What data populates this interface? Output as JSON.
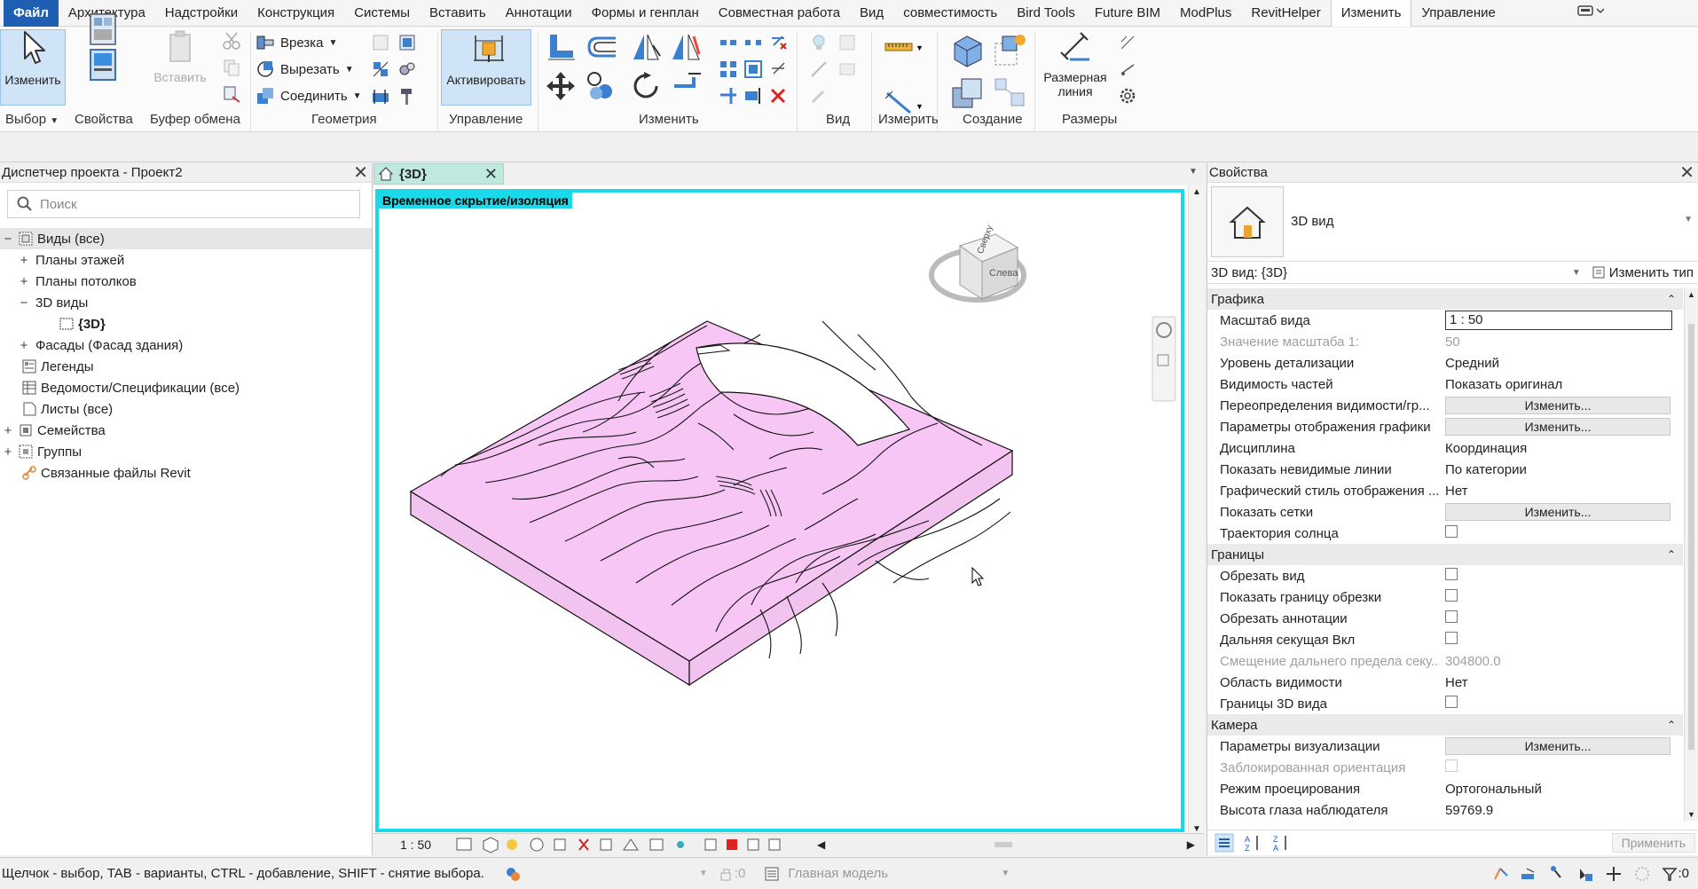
{
  "menu": {
    "items": [
      "Файл",
      "Архитектура",
      "Надстройки",
      "Конструкция",
      "Системы",
      "Вставить",
      "Аннотации",
      "Формы и генплан",
      "Совместная работа",
      "Вид",
      "совместимость",
      "Bird Tools",
      "Future BIM",
      "ModPlus",
      "RevitHelper",
      "Изменить",
      "Управление"
    ]
  },
  "ribbon": {
    "modify_label": "Изменить",
    "insert_label": "Вставить",
    "cut_small": "Врезка",
    "cutout_small": "Вырезать",
    "join_small": "Соединить",
    "activate_label": "Активировать",
    "dimension_label_1": "Размерная",
    "dimension_label_2": "линия",
    "panels": {
      "select": "Выбор",
      "properties": "Свойства",
      "clipboard": "Буфер обмена",
      "geometry": "Геометрия",
      "control": "Управление",
      "modify": "Изменить",
      "view": "Вид",
      "measure": "Измерить",
      "create": "Создание",
      "dimensions": "Размеры"
    }
  },
  "browser": {
    "title": "Диспетчер проекта - Проект2",
    "search_placeholder": "Поиск",
    "items": [
      {
        "label": "Виды (все)",
        "toggle": "−"
      },
      {
        "label": "Планы этажей",
        "toggle": "+"
      },
      {
        "label": "Планы потолков",
        "toggle": "+"
      },
      {
        "label": "3D виды",
        "toggle": "−"
      },
      {
        "label": "{3D}",
        "toggle": ""
      },
      {
        "label": "Фасады (Фасад здания)",
        "toggle": "+"
      },
      {
        "label": "Легенды",
        "toggle": ""
      },
      {
        "label": "Ведомости/Спецификации (все)",
        "toggle": ""
      },
      {
        "label": "Листы (все)",
        "toggle": ""
      },
      {
        "label": "Семейства",
        "toggle": "+"
      },
      {
        "label": "Группы",
        "toggle": "+"
      },
      {
        "label": "Связанные файлы Revit",
        "toggle": ""
      }
    ]
  },
  "view": {
    "tab_label": "{3D}",
    "isolation_label": "Временное скрытие/изоляция",
    "scale": "1 : 50",
    "viewcube_face": "Слева",
    "viewcube_top": "Сверху"
  },
  "properties": {
    "title": "Свойства",
    "type_name": "3D вид",
    "selector": "3D вид: {3D}",
    "edit_type": "Изменить тип",
    "groups": {
      "graphics": "Графика",
      "extents": "Границы",
      "camera": "Камера"
    },
    "rows": {
      "scale_name": "Масштаб вида",
      "scale_value": "1 : 50",
      "scale_val_name": "Значение масштаба    1:",
      "scale_val_value": "50",
      "detail_name": "Уровень детализации",
      "detail_value": "Средний",
      "parts_name": "Видимость частей",
      "parts_value": "Показать оригинал",
      "overrides_name": "Переопределения видимости/гр...",
      "overrides_value": "Изменить...",
      "graphics_opts_name": "Параметры отображения графики",
      "graphics_opts_value": "Изменить...",
      "discipline_name": "Дисциплина",
      "discipline_value": "Координация",
      "hidden_name": "Показать невидимые линии",
      "hidden_value": "По категории",
      "style_name": "Графический стиль отображения ...",
      "style_value": "Нет",
      "grids_name": "Показать сетки",
      "grids_value": "Изменить...",
      "sunpath_name": "Траектория солнца",
      "crop_name": "Обрезать вид",
      "cropshow_name": "Показать границу обрезки",
      "cropanno_name": "Обрезать аннотации",
      "farclip_name": "Дальняя секущая Вкл",
      "faroffset_name": "Смещение дальнего предела секу...",
      "faroffset_value": "304800.0",
      "scope_name": "Область видимости",
      "scope_value": "Нет",
      "bounds3d_name": "Границы 3D вида",
      "render_name": "Параметры визуализации",
      "render_value": "Изменить...",
      "locked_name": "Заблокированная ориентация",
      "projection_name": "Режим проецирования",
      "projection_value": "Ортогональный",
      "eye_name": "Высота глаза наблюдателя",
      "eye_value": "59769.9"
    },
    "apply_label": "Применить"
  },
  "status": {
    "hint": "Щелчок - выбор, TAB - варианты, CTRL - добавление, SHIFT - снятие выбора.",
    "workset_value": ":0",
    "model_placeholder": "Главная модель",
    "filter_count": ":0"
  },
  "colors": {
    "accent": "#1f5fb3",
    "isolation": "#1ad9e8",
    "topo": "#f7c6f4",
    "tab": "#bfe8de"
  }
}
